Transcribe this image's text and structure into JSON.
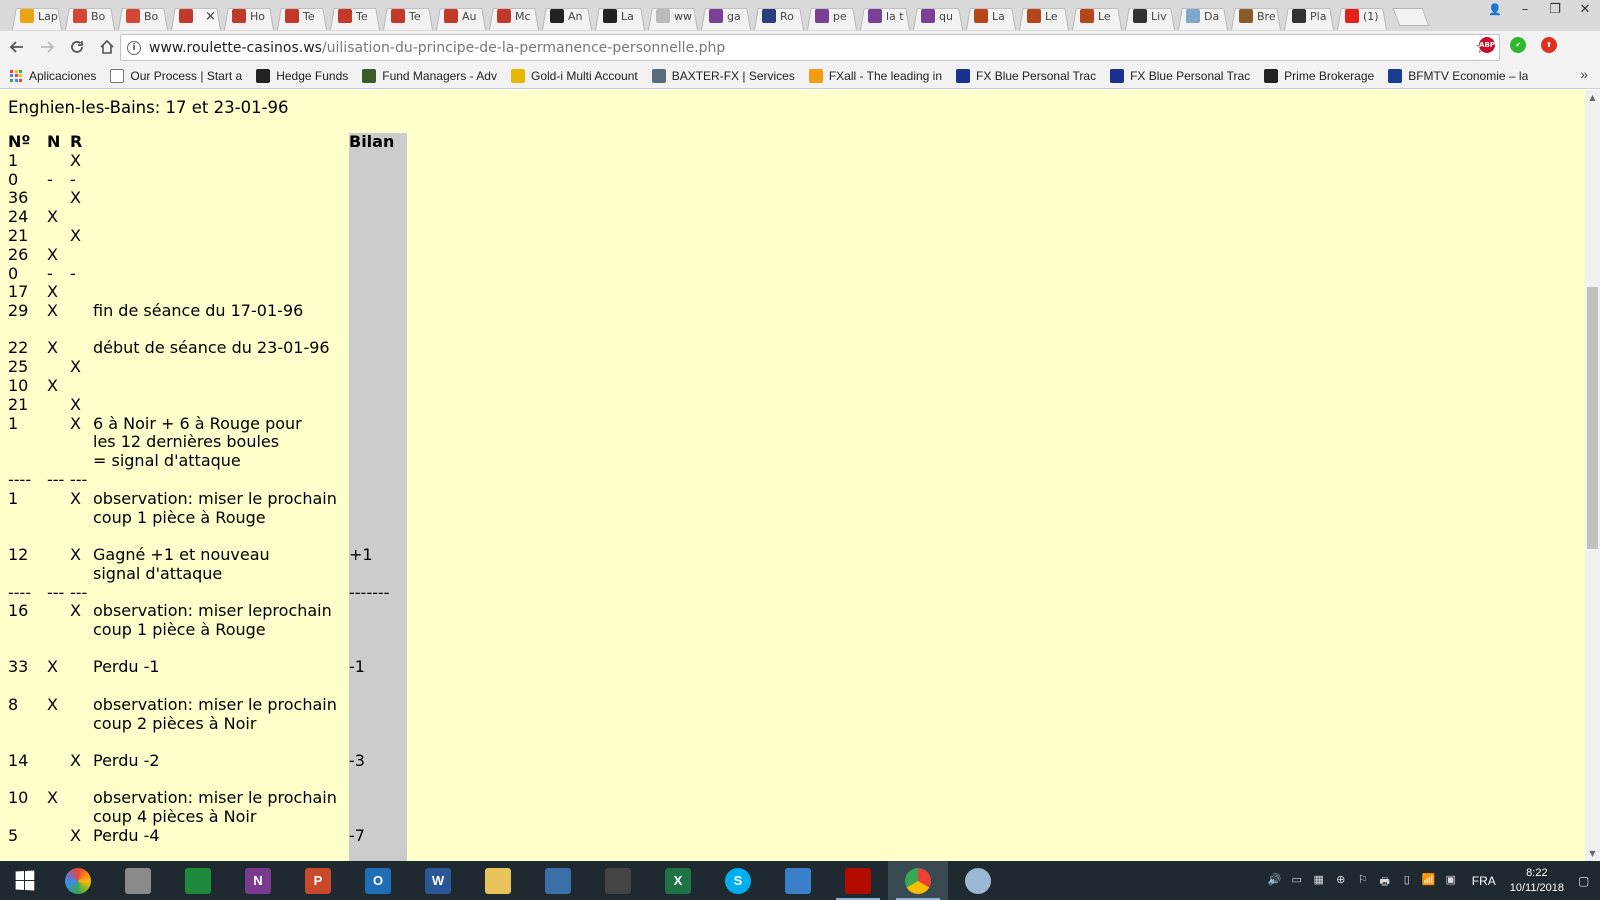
{
  "browser": {
    "tabs": [
      {
        "label": "Lap",
        "icon": "envelope-icon",
        "color": "#e8a317"
      },
      {
        "label": "Bo",
        "icon": "gmail-icon",
        "color": "#d44638"
      },
      {
        "label": "Bo",
        "icon": "gmail-icon",
        "color": "#d44638"
      },
      {
        "label": "",
        "icon": "roulette-icon",
        "color": "#c0392b",
        "active": true
      },
      {
        "label": "Ho",
        "icon": "roulette-icon",
        "color": "#c0392b"
      },
      {
        "label": "Te",
        "icon": "roulette-icon",
        "color": "#c0392b"
      },
      {
        "label": "Te",
        "icon": "roulette-icon",
        "color": "#c0392b"
      },
      {
        "label": "Te",
        "icon": "roulette-icon",
        "color": "#c0392b"
      },
      {
        "label": "Au",
        "icon": "roulette-icon",
        "color": "#c0392b"
      },
      {
        "label": "Mc",
        "icon": "roulette-icon",
        "color": "#c0392b"
      },
      {
        "label": "An",
        "icon": "amazon-icon",
        "color": "#222222"
      },
      {
        "label": "La",
        "icon": "amazon-icon",
        "color": "#222222"
      },
      {
        "label": "ww",
        "icon": "page-icon",
        "color": "#bbbbbb"
      },
      {
        "label": "ga",
        "icon": "m-icon",
        "color": "#7b3f98"
      },
      {
        "label": "Ro",
        "icon": "sj-icon",
        "color": "#2a3d7c"
      },
      {
        "label": "pe",
        "icon": "m-icon",
        "color": "#7b3f98"
      },
      {
        "label": "la t",
        "icon": "m-icon",
        "color": "#7b3f98"
      },
      {
        "label": "qu",
        "icon": "m-icon",
        "color": "#7b3f98"
      },
      {
        "label": "La",
        "icon": "book-icon",
        "color": "#b5451b"
      },
      {
        "label": "Le",
        "icon": "book-icon",
        "color": "#b5451b"
      },
      {
        "label": "Le",
        "icon": "book-icon",
        "color": "#b5451b"
      },
      {
        "label": "Liv",
        "icon": "plus-icon",
        "color": "#333333"
      },
      {
        "label": "Da",
        "icon": "cat-icon",
        "color": "#7fa7c9"
      },
      {
        "label": "Bre",
        "icon": "globe-icon",
        "color": "#8a5a2b"
      },
      {
        "label": "Pla",
        "icon": "download-icon",
        "color": "#333333"
      },
      {
        "label": "(1)",
        "icon": "youtube-icon",
        "color": "#e62117"
      }
    ],
    "active_tab_close": "×",
    "window_controls": {
      "profile": "👤",
      "minimize": "–",
      "restore": "❐",
      "close": "✕"
    },
    "url_host": "www.roulette-casinos.ws",
    "url_path": "/uilisation-du-principe-de-la-permanence-personnelle.php",
    "extensions": [
      {
        "label": "ABP",
        "color": "#c70d2c"
      },
      {
        "label": "✔",
        "color": "#2eb82e"
      },
      {
        "label": "⬆",
        "color": "#e0301e"
      }
    ],
    "bookmarks": [
      {
        "label": "Aplicaciones",
        "icon": "apps-icon",
        "color": "#4285f4"
      },
      {
        "label": "Our Process | Start a",
        "icon": "page-icon",
        "color": "#ffffff"
      },
      {
        "label": "Hedge Funds",
        "icon": "sh-icon",
        "color": "#222222"
      },
      {
        "label": "Fund Managers - Adv",
        "icon": "hfm-icon",
        "color": "#3c5a2a"
      },
      {
        "label": "Gold-i Multi Account",
        "icon": "gold-icon",
        "color": "#e6b800"
      },
      {
        "label": "BAXTER-FX | Services",
        "icon": "baxter-icon",
        "color": "#5a6b7a"
      },
      {
        "label": "FXall - The leading in",
        "icon": "fxall-icon",
        "color": "#f39c12"
      },
      {
        "label": "FX Blue Personal Trac",
        "icon": "fxblue-icon",
        "color": "#1b2f8f"
      },
      {
        "label": "FX Blue Personal Trac",
        "icon": "fxblue-icon",
        "color": "#1b2f8f"
      },
      {
        "label": "Prime Brokerage",
        "icon": "pb-icon",
        "color": "#222222"
      },
      {
        "label": "BFMTV Economie – la",
        "icon": "bfm-icon",
        "color": "#1a3d8f"
      }
    ],
    "bookmarks_more": "»"
  },
  "page": {
    "title": "Enghien-les-Bains: 17 et 23-01-96",
    "columns": {
      "num": "Nº",
      "noir": "N",
      "rouge": "R",
      "bilan": "Bilan"
    },
    "rows": [
      {
        "n": "1",
        "noir": "",
        "rouge": "X",
        "text": [],
        "bilan": ""
      },
      {
        "n": "0",
        "noir": "-",
        "rouge": "-",
        "text": [],
        "bilan": ""
      },
      {
        "n": "36",
        "noir": "",
        "rouge": "X",
        "text": [],
        "bilan": ""
      },
      {
        "n": "24",
        "noir": "X",
        "rouge": "",
        "text": [],
        "bilan": ""
      },
      {
        "n": "21",
        "noir": "",
        "rouge": "X",
        "text": [],
        "bilan": ""
      },
      {
        "n": "26",
        "noir": "X",
        "rouge": "",
        "text": [],
        "bilan": ""
      },
      {
        "n": "0",
        "noir": "-",
        "rouge": "-",
        "text": [],
        "bilan": ""
      },
      {
        "n": "17",
        "noir": "X",
        "rouge": "",
        "text": [],
        "bilan": ""
      },
      {
        "n": "29",
        "noir": "X",
        "rouge": "",
        "text": [
          "fin de séance du 17-01-96"
        ],
        "bilan": "",
        "gap": true
      },
      {
        "n": "22",
        "noir": "X",
        "rouge": "",
        "text": [
          "début de séance du 23-01-96"
        ],
        "bilan": ""
      },
      {
        "n": "25",
        "noir": "",
        "rouge": "X",
        "text": [],
        "bilan": ""
      },
      {
        "n": "10",
        "noir": "X",
        "rouge": "",
        "text": [],
        "bilan": ""
      },
      {
        "n": "21",
        "noir": "",
        "rouge": "X",
        "text": [],
        "bilan": ""
      },
      {
        "n": "1",
        "noir": "",
        "rouge": "X",
        "text": [
          "6 à Noir + 6 à Rouge pour",
          "les 12 dernières boules",
          "= signal d'attaque"
        ],
        "bilan": ""
      },
      {
        "n": "----",
        "noir": "---",
        "rouge": "---",
        "text": [],
        "bilan": ""
      },
      {
        "n": "1",
        "noir": "",
        "rouge": "X",
        "text": [
          "observation: miser le prochain",
          "coup 1 pièce à Rouge"
        ],
        "bilan": "",
        "gap": true
      },
      {
        "n": "12",
        "noir": "",
        "rouge": "X",
        "text": [
          "Gagné +1 et nouveau",
          "signal d'attaque"
        ],
        "bilan": "+1"
      },
      {
        "n": "----",
        "noir": "---",
        "rouge": "---",
        "text": [],
        "bilan": "-------"
      },
      {
        "n": "16",
        "noir": "",
        "rouge": "X",
        "text": [
          "observation: miser leprochain",
          "coup 1 pièce à Rouge"
        ],
        "bilan": "",
        "gap": true
      },
      {
        "n": "33",
        "noir": "X",
        "rouge": "",
        "text": [
          "Perdu -1"
        ],
        "bilan": "-1",
        "gap": true
      },
      {
        "n": "8",
        "noir": "X",
        "rouge": "",
        "text": [
          "observation: miser le prochain",
          "coup 2 pièces à Noir"
        ],
        "bilan": "",
        "gap": true
      },
      {
        "n": "14",
        "noir": "",
        "rouge": "X",
        "text": [
          "Perdu -2"
        ],
        "bilan": "-3",
        "gap": true
      },
      {
        "n": "10",
        "noir": "X",
        "rouge": "",
        "text": [
          "observation: miser le prochain",
          "coup 4 pièces à Noir"
        ],
        "bilan": ""
      },
      {
        "n": "5",
        "noir": "",
        "rouge": "X",
        "text": [
          "Perdu -4"
        ],
        "bilan": "-7"
      }
    ]
  },
  "scrollbar": {
    "position": 0.38
  },
  "taskbar": {
    "apps": [
      {
        "name": "picasa-app",
        "label": "",
        "color": "#e07b1f"
      },
      {
        "name": "notepad-app",
        "label": "",
        "color": "#8a8a8a"
      },
      {
        "name": "store-app",
        "label": "",
        "color": "#1e8a3c"
      },
      {
        "name": "onenote-app",
        "label": "N",
        "color": "#7a3b8f"
      },
      {
        "name": "powerpoint-app",
        "label": "P",
        "color": "#c94a2a"
      },
      {
        "name": "outlook-app",
        "label": "O",
        "color": "#1f6fb8"
      },
      {
        "name": "word-app",
        "label": "W",
        "color": "#2b5797"
      },
      {
        "name": "explorer-app",
        "label": "",
        "color": "#e8c25a"
      },
      {
        "name": "owl-app",
        "label": "",
        "color": "#3a6fa8"
      },
      {
        "name": "fox-app",
        "label": "",
        "color": "#444444"
      },
      {
        "name": "excel-app",
        "label": "X",
        "color": "#1f7244"
      },
      {
        "name": "skype-app",
        "label": "S",
        "color": "#00aff0"
      },
      {
        "name": "network-app",
        "label": "",
        "color": "#3a80c9"
      },
      {
        "name": "acrobat-app",
        "label": "",
        "color": "#b30b00",
        "running": true
      },
      {
        "name": "chrome-app",
        "label": "",
        "color": "#4285f4",
        "running": true,
        "active": true
      },
      {
        "name": "paint-app",
        "label": "",
        "color": "#9bb7d4"
      }
    ],
    "tray_icons": [
      "🔊",
      "▭",
      "▦",
      "⊕",
      "⚐",
      "🖶",
      "▯",
      "📶",
      "▣"
    ],
    "language": "FRA",
    "time": "8:22",
    "date": "10/11/2018",
    "notification": "▢"
  }
}
